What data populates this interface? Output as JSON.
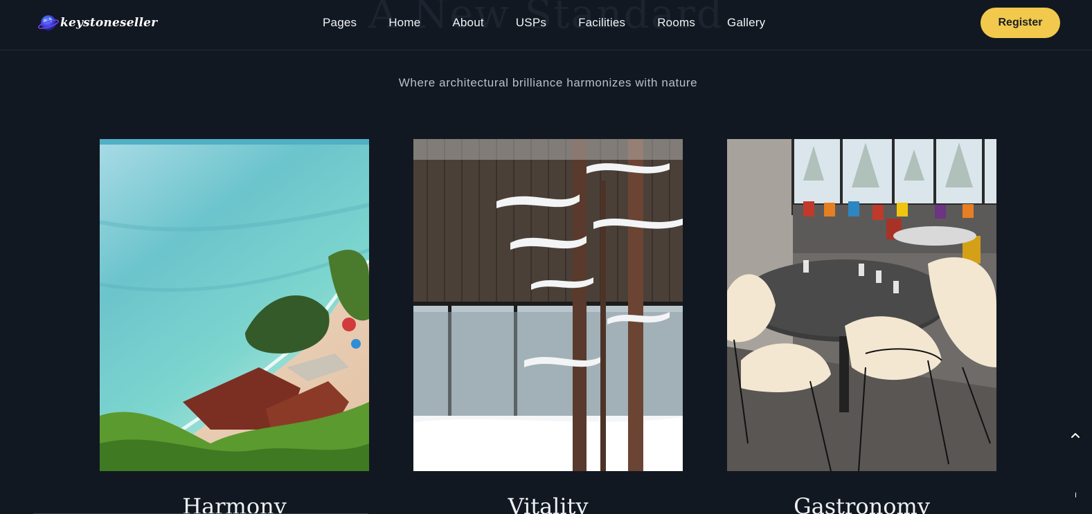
{
  "brand": {
    "name": "keystoneseller",
    "logo_icon": "globe-icon"
  },
  "nav": {
    "items": [
      {
        "label": "Pages"
      },
      {
        "label": "Home"
      },
      {
        "label": "About"
      },
      {
        "label": "USPs"
      },
      {
        "label": "Facilities"
      },
      {
        "label": "Rooms"
      },
      {
        "label": "Gallery"
      }
    ],
    "register_label": "Register"
  },
  "section": {
    "heading": "A New Standard",
    "subtitle": "Where architectural brilliance harmonizes with nature"
  },
  "cards": [
    {
      "title": "Harmony",
      "image": "beach-coastline-photo"
    },
    {
      "title": "Vitality",
      "image": "snowy-pine-trees-photo"
    },
    {
      "title": "Gastronomy",
      "image": "restaurant-dining-room-photo"
    }
  ],
  "scroll_top_icon": "chevron-up-icon",
  "colors": {
    "background": "#121821",
    "accent": "#f2c94c",
    "text": "#e8eaee",
    "muted_text": "#b9c0ca"
  }
}
